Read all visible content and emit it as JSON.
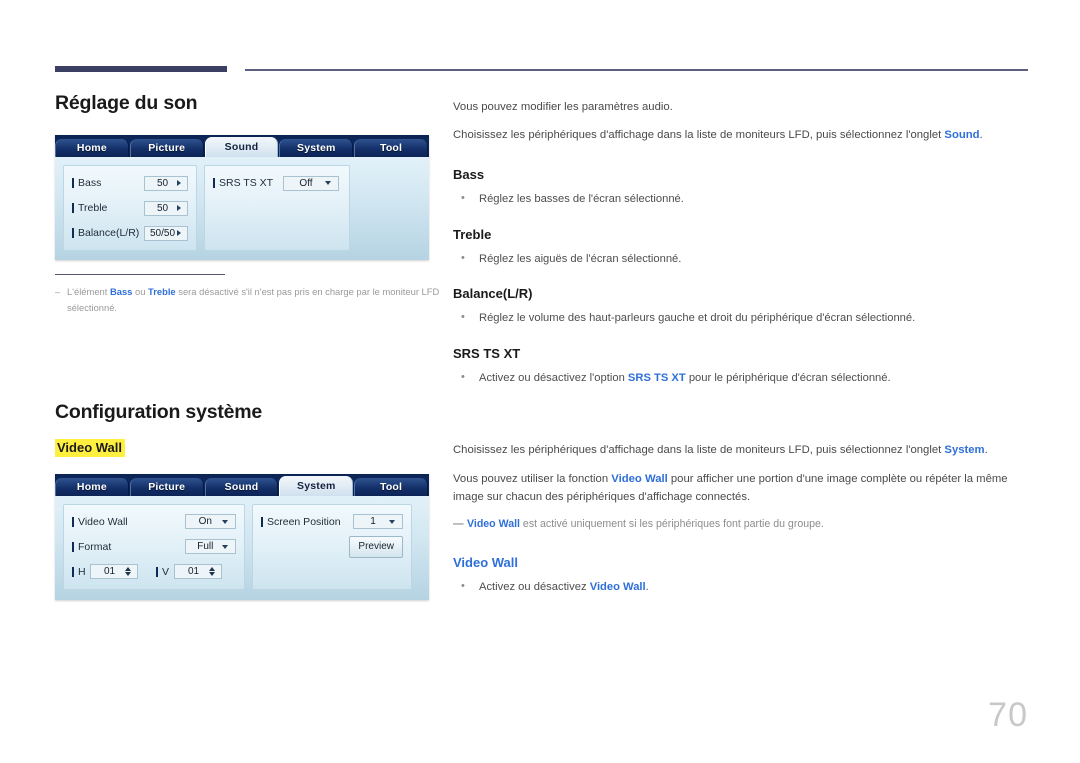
{
  "page": {
    "number": "70"
  },
  "sound_section": {
    "title": "Réglage du son",
    "intro_1": "Vous pouvez modifier les paramètres audio.",
    "intro_2_pre": "Choisissez les périphériques d'affichage dans la liste de moniteurs LFD, puis sélectionnez l'onglet ",
    "intro_2_link": "Sound",
    "intro_2_post": ".",
    "items": [
      {
        "heading": "Bass",
        "bullet": "Réglez les basses de l'écran sélectionné."
      },
      {
        "heading": "Treble",
        "bullet": "Réglez les aiguës de l'écran sélectionné."
      },
      {
        "heading": "Balance(L/R)",
        "bullet": "Réglez le volume des haut-parleurs gauche et droit du périphérique d'écran sélectionné."
      },
      {
        "heading": "SRS TS XT",
        "bullet_pre": "Activez ou désactivez l'option ",
        "bullet_link": "SRS TS XT",
        "bullet_post": " pour le périphérique d'écran sélectionné."
      }
    ],
    "footnote": {
      "dash": "–",
      "pre": "L'élément ",
      "link1": "Bass",
      "mid1": " ou ",
      "link2": "Treble",
      "post": " sera désactivé s'il n'est pas pris en charge par le moniteur LFD sélectionné."
    }
  },
  "sound_osd": {
    "tabs": [
      {
        "label": "Home",
        "active": false
      },
      {
        "label": "Picture",
        "active": false
      },
      {
        "label": "Sound",
        "active": true
      },
      {
        "label": "System",
        "active": false
      },
      {
        "label": "Tool",
        "active": false
      }
    ],
    "left_rows": [
      {
        "label": "Bass",
        "value": "50",
        "control": "arrow-right"
      },
      {
        "label": "Treble",
        "value": "50",
        "control": "arrow-right"
      },
      {
        "label": "Balance(L/R)",
        "value": "50/50",
        "control": "arrow-right"
      }
    ],
    "right_rows": [
      {
        "label": "SRS TS XT",
        "value": "Off",
        "control": "arrow-down"
      }
    ]
  },
  "system_section": {
    "title": "Configuration système",
    "highlight_heading": "Video Wall",
    "intro_1_pre": "Choisissez les périphériques d'affichage dans la liste de moniteurs LFD, puis sélectionnez l'onglet ",
    "intro_1_link": "System",
    "intro_1_post": ".",
    "intro_2_pre": "Vous pouvez utiliser la fonction ",
    "intro_2_link": "Video Wall",
    "intro_2_post": " pour afficher une portion d'une image complète ou répéter la même image sur chacun des périphériques d'affichage connectés.",
    "note": {
      "dash": "―",
      "link": "Video Wall",
      "text": " est activé uniquement si les périphériques font partie du groupe."
    },
    "item_heading": "Video Wall",
    "item_bullet_pre": "Activez ou désactivez ",
    "item_bullet_link": "Video Wall",
    "item_bullet_post": "."
  },
  "system_osd": {
    "tabs": [
      {
        "label": "Home",
        "active": false
      },
      {
        "label": "Picture",
        "active": false
      },
      {
        "label": "Sound",
        "active": false
      },
      {
        "label": "System",
        "active": true
      },
      {
        "label": "Tool",
        "active": false
      }
    ],
    "left_rows": [
      {
        "label": "Video Wall",
        "value": "On",
        "control": "arrow-down"
      },
      {
        "label": "Format",
        "value": "Full",
        "control": "arrow-down"
      }
    ],
    "hv_row": [
      {
        "label": "H",
        "value": "01",
        "control": "spinner"
      },
      {
        "label": "V",
        "value": "01",
        "control": "spinner"
      }
    ],
    "right_rows": [
      {
        "label": "Screen Position",
        "value": "1",
        "control": "arrow-down"
      }
    ],
    "preview_button": "Preview"
  },
  "colors": {
    "accent_blue": "#2f6fd8",
    "rule_navy": "#3b3f63",
    "highlight_yellow": "#ffef3f",
    "osd_tab_navy": "#0d2a61"
  }
}
